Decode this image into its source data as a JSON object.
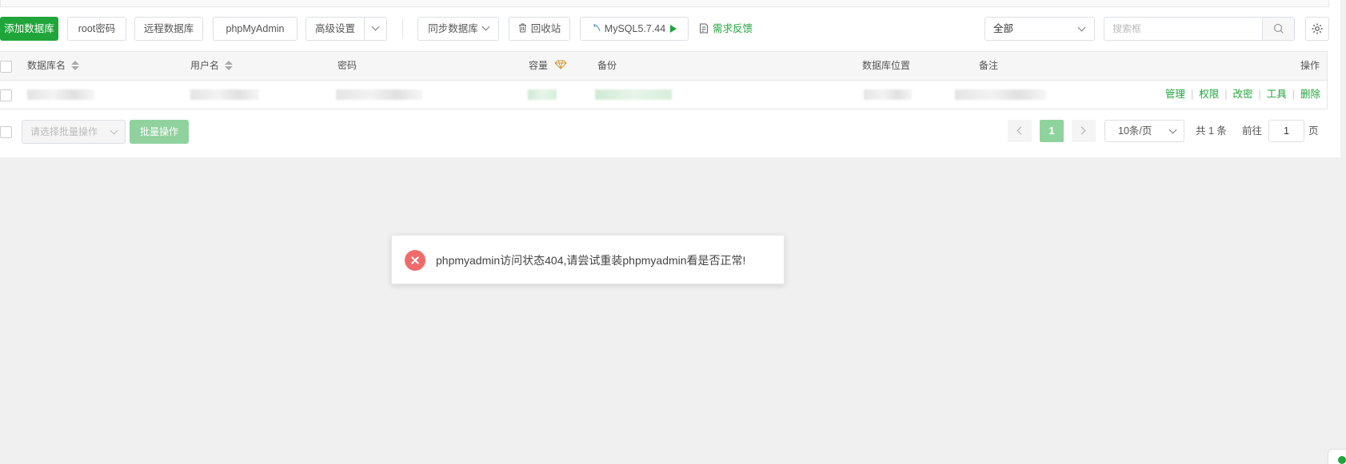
{
  "toolbar": {
    "add_db": "添加数据库",
    "root_password": "root密码",
    "remote_db": "远程数据库",
    "phpmyadmin": "phpMyAdmin",
    "advanced": "高级设置",
    "sync_db": "同步数据库",
    "recycle": "回收站",
    "mysql_version": "MySQL5.7.44",
    "feedback": "需求反馈",
    "filter_selected": "全部",
    "search_placeholder": "搜索框"
  },
  "table": {
    "headers": {
      "db_name": "数据库名",
      "username": "用户名",
      "password": "密码",
      "capacity": "容量",
      "backup": "备份",
      "location": "数据库位置",
      "remark": "备注",
      "actions": "操作"
    },
    "row_actions": [
      "管理",
      "权限",
      "改密",
      "工具",
      "删除"
    ]
  },
  "footer": {
    "batch_placeholder": "请选择批量操作",
    "batch_button": "批量操作",
    "current_page": "1",
    "per_page": "10条/页",
    "total": "共 1 条",
    "goto_label": "前往",
    "goto_value": "1",
    "page_suffix": "页"
  },
  "toast": {
    "message": "phpmyadmin访问状态404,请尝试重装phpmyadmin看是否正常!"
  },
  "colors": {
    "accent": "#20a53a",
    "error": "#ef6b6b"
  }
}
